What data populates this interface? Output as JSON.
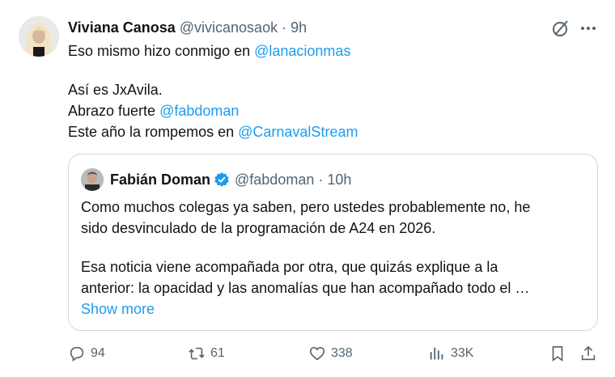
{
  "tweet": {
    "author": {
      "name": "Viviana Canosa",
      "handle": "@vivicanosaok",
      "separator": "·",
      "time": "9h"
    },
    "text": {
      "line1_pre": "Eso mismo hizo conmigo en ",
      "line1_mention": "@lanacionmas",
      "line2": "Así es JxAvila.",
      "line3_pre": "Abrazo fuerte ",
      "line3_mention": "@fabdoman",
      "line4_pre": "Este año la rompemos en ",
      "line4_mention": "@CarnavalStream"
    }
  },
  "quote": {
    "author": {
      "name": "Fabián Doman",
      "handle": "@fabdoman",
      "separator": "·",
      "time": "10h",
      "verified": true
    },
    "text": {
      "line1": "Como muchos colegas ya saben, pero ustedes probablemente no, he",
      "line2": "sido desvinculado de la programación de A24 en 2026.",
      "line3": "Esa noticia viene acompañada por otra, que quizás explique a la",
      "line4": "anterior: la opacidad y las anomalías que han acompañado todo el …"
    },
    "show_more_label": "Show more"
  },
  "actions": {
    "replies": "94",
    "reposts": "61",
    "likes": "338",
    "views": "33K"
  },
  "colors": {
    "accent": "#1d9bf0",
    "text": "#0f1419",
    "muted": "#536471",
    "border": "#cfd9de"
  }
}
